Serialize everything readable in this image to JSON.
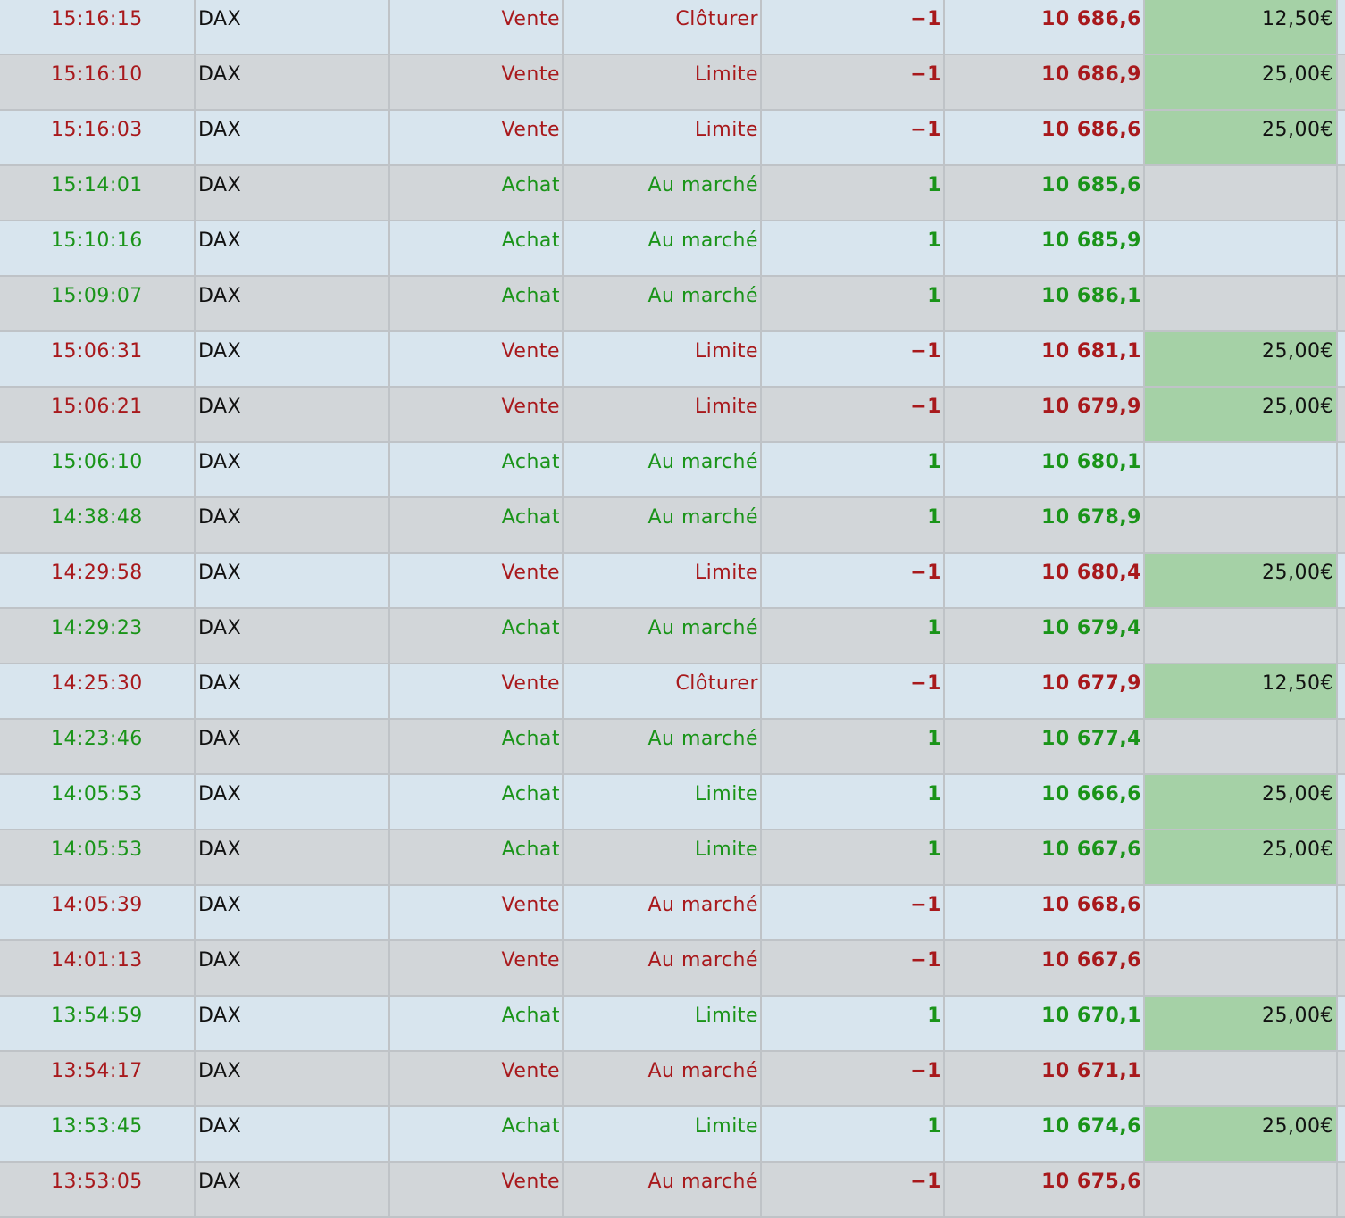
{
  "colors": {
    "sell_text": "#a8191c",
    "buy_text": "#1a9419",
    "row_light": "#d8e5ee",
    "row_dark": "#d2d6d9",
    "fee_highlight": "#a5d1a6"
  },
  "trades": [
    {
      "time": "15:16:15",
      "symbol": "DAX",
      "side": "Vente",
      "order_type": "Clôturer",
      "qty": "−1",
      "price": "10 686,6",
      "fee": "12,50€",
      "direction": "sell"
    },
    {
      "time": "15:16:10",
      "symbol": "DAX",
      "side": "Vente",
      "order_type": "Limite",
      "qty": "−1",
      "price": "10 686,9",
      "fee": "25,00€",
      "direction": "sell"
    },
    {
      "time": "15:16:03",
      "symbol": "DAX",
      "side": "Vente",
      "order_type": "Limite",
      "qty": "−1",
      "price": "10 686,6",
      "fee": "25,00€",
      "direction": "sell"
    },
    {
      "time": "15:14:01",
      "symbol": "DAX",
      "side": "Achat",
      "order_type": "Au marché",
      "qty": "1",
      "price": "10 685,6",
      "fee": "",
      "direction": "buy"
    },
    {
      "time": "15:10:16",
      "symbol": "DAX",
      "side": "Achat",
      "order_type": "Au marché",
      "qty": "1",
      "price": "10 685,9",
      "fee": "",
      "direction": "buy"
    },
    {
      "time": "15:09:07",
      "symbol": "DAX",
      "side": "Achat",
      "order_type": "Au marché",
      "qty": "1",
      "price": "10 686,1",
      "fee": "",
      "direction": "buy"
    },
    {
      "time": "15:06:31",
      "symbol": "DAX",
      "side": "Vente",
      "order_type": "Limite",
      "qty": "−1",
      "price": "10 681,1",
      "fee": "25,00€",
      "direction": "sell"
    },
    {
      "time": "15:06:21",
      "symbol": "DAX",
      "side": "Vente",
      "order_type": "Limite",
      "qty": "−1",
      "price": "10 679,9",
      "fee": "25,00€",
      "direction": "sell"
    },
    {
      "time": "15:06:10",
      "symbol": "DAX",
      "side": "Achat",
      "order_type": "Au marché",
      "qty": "1",
      "price": "10 680,1",
      "fee": "",
      "direction": "buy"
    },
    {
      "time": "14:38:48",
      "symbol": "DAX",
      "side": "Achat",
      "order_type": "Au marché",
      "qty": "1",
      "price": "10 678,9",
      "fee": "",
      "direction": "buy"
    },
    {
      "time": "14:29:58",
      "symbol": "DAX",
      "side": "Vente",
      "order_type": "Limite",
      "qty": "−1",
      "price": "10 680,4",
      "fee": "25,00€",
      "direction": "sell"
    },
    {
      "time": "14:29:23",
      "symbol": "DAX",
      "side": "Achat",
      "order_type": "Au marché",
      "qty": "1",
      "price": "10 679,4",
      "fee": "",
      "direction": "buy"
    },
    {
      "time": "14:25:30",
      "symbol": "DAX",
      "side": "Vente",
      "order_type": "Clôturer",
      "qty": "−1",
      "price": "10 677,9",
      "fee": "12,50€",
      "direction": "sell"
    },
    {
      "time": "14:23:46",
      "symbol": "DAX",
      "side": "Achat",
      "order_type": "Au marché",
      "qty": "1",
      "price": "10 677,4",
      "fee": "",
      "direction": "buy"
    },
    {
      "time": "14:05:53",
      "symbol": "DAX",
      "side": "Achat",
      "order_type": "Limite",
      "qty": "1",
      "price": "10 666,6",
      "fee": "25,00€",
      "direction": "buy"
    },
    {
      "time": "14:05:53",
      "symbol": "DAX",
      "side": "Achat",
      "order_type": "Limite",
      "qty": "1",
      "price": "10 667,6",
      "fee": "25,00€",
      "direction": "buy"
    },
    {
      "time": "14:05:39",
      "symbol": "DAX",
      "side": "Vente",
      "order_type": "Au marché",
      "qty": "−1",
      "price": "10 668,6",
      "fee": "",
      "direction": "sell"
    },
    {
      "time": "14:01:13",
      "symbol": "DAX",
      "side": "Vente",
      "order_type": "Au marché",
      "qty": "−1",
      "price": "10 667,6",
      "fee": "",
      "direction": "sell"
    },
    {
      "time": "13:54:59",
      "symbol": "DAX",
      "side": "Achat",
      "order_type": "Limite",
      "qty": "1",
      "price": "10 670,1",
      "fee": "25,00€",
      "direction": "buy"
    },
    {
      "time": "13:54:17",
      "symbol": "DAX",
      "side": "Vente",
      "order_type": "Au marché",
      "qty": "−1",
      "price": "10 671,1",
      "fee": "",
      "direction": "sell"
    },
    {
      "time": "13:53:45",
      "symbol": "DAX",
      "side": "Achat",
      "order_type": "Limite",
      "qty": "1",
      "price": "10 674,6",
      "fee": "25,00€",
      "direction": "buy"
    },
    {
      "time": "13:53:05",
      "symbol": "DAX",
      "side": "Vente",
      "order_type": "Au marché",
      "qty": "−1",
      "price": "10 675,6",
      "fee": "",
      "direction": "sell"
    }
  ]
}
